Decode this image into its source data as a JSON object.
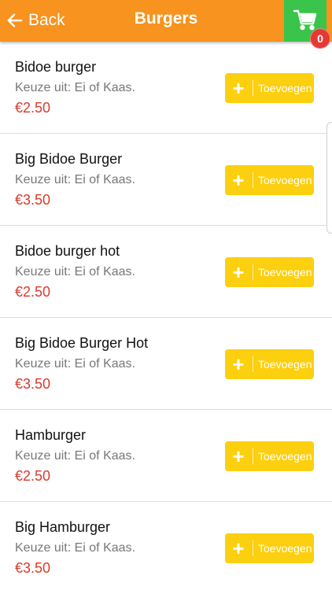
{
  "header": {
    "back_label": "Back",
    "title": "Burgers",
    "cart_count": "0"
  },
  "colors": {
    "header": "#f7931e",
    "cart": "#3bc44b",
    "badge": "#e53935",
    "button": "#fccf0f",
    "price": "#d93b2b"
  },
  "icons": {
    "back": "arrow-left-icon",
    "cart": "shopping-cart-icon",
    "add": "plus-icon"
  },
  "products": [
    {
      "name": "Bidoe burger",
      "description": "Keuze uit: Ei of Kaas.",
      "price": "€2.50",
      "button_label": "Toevoegen"
    },
    {
      "name": "Big Bidoe Burger",
      "description": "Keuze uit: Ei of Kaas.",
      "price": "€3.50",
      "button_label": "Toevoegen"
    },
    {
      "name": "Bidoe burger hot",
      "description": "Keuze uit: Ei of Kaas.",
      "price": "€2.50",
      "button_label": "Toevoegen"
    },
    {
      "name": "Big Bidoe Burger Hot",
      "description": "Keuze uit: Ei of Kaas.",
      "price": "€3.50",
      "button_label": "Toevoegen"
    },
    {
      "name": "Hamburger",
      "description": "Keuze uit: Ei of Kaas.",
      "price": "€2.50",
      "button_label": "Toevoegen"
    },
    {
      "name": "Big Hamburger",
      "description": "Keuze uit: Ei of Kaas.",
      "price": "€3.50",
      "button_label": "Toevoegen"
    }
  ]
}
